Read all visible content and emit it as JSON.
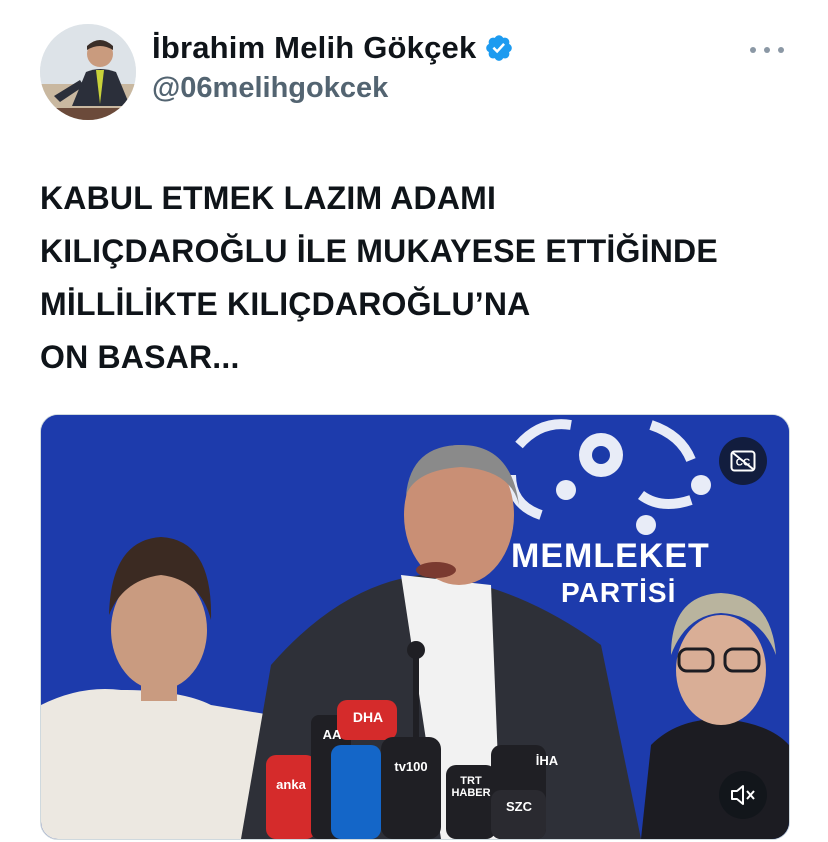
{
  "author": {
    "display_name": "İbrahim Melih Gökçek",
    "handle": "@06melihgokcek",
    "verified": true
  },
  "tweet": {
    "text": "KABUL ETMEK LAZIM ADAMI\nKILIÇDAROĞLU İLE MUKAYESE ETTİĞİNDE\nMİLLİLİKTE KILIÇDAROĞLU’NA\nON BASAR..."
  },
  "media": {
    "type": "video",
    "backdrop_logo": {
      "line1": "MEMLEKET",
      "line2": "PARTİSİ"
    },
    "mic_labels": [
      "DHA",
      "AA",
      "anka",
      "tv100",
      "İHA",
      "TRT HABER",
      "SZC"
    ],
    "controls": {
      "captions_icon": "closed-captions-icon",
      "mute_icon": "muted-speaker-icon"
    },
    "colors": {
      "backdrop": "#1b3aa8"
    }
  },
  "icons": {
    "more": "more-horizontal-icon",
    "verified": "verified-badge-icon"
  },
  "colors": {
    "verified": "#1d9bf0",
    "handle": "#536471",
    "text": "#0f1419"
  }
}
